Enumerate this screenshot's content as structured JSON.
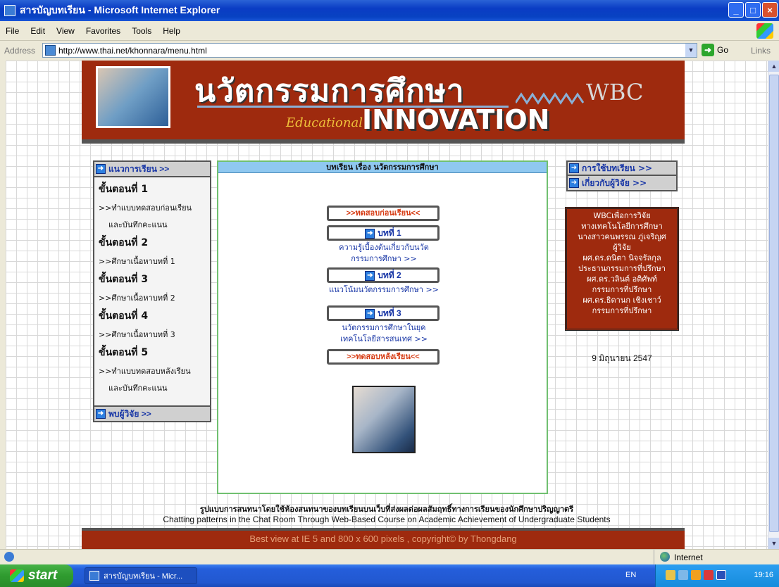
{
  "window": {
    "title": "สารบัญบทเรียน - Microsoft Internet Explorer",
    "minimize": "_",
    "maximize": "□",
    "close": "×"
  },
  "menu": [
    "File",
    "Edit",
    "View",
    "Favorites",
    "Tools",
    "Help"
  ],
  "address": {
    "label": "Address",
    "url": "http://www.thai.net/khonnara/menu.html",
    "go": "Go",
    "links": "Links"
  },
  "banner": {
    "thai_title": "นวัตกรรมการศึกษา",
    "edu": "Educational",
    "innovation": "INNOVATION",
    "wbc": "WBC"
  },
  "left_nav": {
    "header": "แนวการเรียน >>",
    "items": [
      {
        "title": "ขั้นตอนที่ 1",
        "lines": [
          ">>ทำแบบทดสอบก่อนเรียน",
          "และบันทึกคะแนน"
        ]
      },
      {
        "title": "ขั้นตอนที่ 2",
        "lines": [
          ">>ศึกษาเนื้อหาบทที่ 1"
        ]
      },
      {
        "title": "ขั้นตอนที่ 3",
        "lines": [
          ">>ศึกษาเนื้อหาบทที่ 2"
        ]
      },
      {
        "title": "ขั้นตอนที่ 4",
        "lines": [
          ">>ศึกษาเนื้อหาบทที่ 3"
        ]
      },
      {
        "title": "ขั้นตอนที่ 5",
        "lines": [
          ">>ทำแบบทดสอบหลังเรียน",
          "และบันทึกคะแนน"
        ]
      }
    ],
    "footer": "พบผู้วิจัย >>"
  },
  "center": {
    "header": "บทเรียน เรื่อง นวัตกรรมการศึกษา",
    "pretest": ">>ทดสอบก่อนเรียน<<",
    "lesson1": "บทที่ 1",
    "lesson1_desc": [
      "ความรู้เบื้องต้นเกี่ยวกับนวัต",
      "กรรมการศึกษา >>"
    ],
    "lesson2": "บทที่ 2",
    "lesson2_desc": [
      "แนวโน้มนวัตกรรมการศึกษา >>"
    ],
    "lesson3": "บทที่ 3",
    "lesson3_desc": [
      "นวัตกรรมการศึกษาในยุค",
      "เทคโนโลยีสารสนเทศ >>"
    ],
    "posttest": ">>ทดสอบหลังเรียน<<"
  },
  "right_nav": {
    "usage": "การใช้บทเรียน >>",
    "about": "เกี่ยวกับผู้วิจัย >>"
  },
  "info": [
    "WBCเพื่อการวิจัย",
    "ทางเทคโนโลยีการศึกษา",
    "นางสาวคนพรรณ ภู่เจริญศ",
    "ผู้วิจัย",
    "ผศ.ดร.ดนิตา นิจจรัลกุล",
    "ประธานกรรมการที่ปรึกษา",
    "ผศ.ดร.วลินต์ อติศัพท์",
    "กรรมการที่ปรึกษา",
    "ผศ.ดร.ธิดานก เชิงเชาว์",
    "กรรมการที่ปรึกษา"
  ],
  "date": "9 มิถุนายน 2547",
  "footer": {
    "thai": "รูปแบบการสนทนาโดยใช้ห้องสนทนาของบทเรียนบนเว็บที่ส่งผลต่อผลสัมฤทธิ์ทางการเรียนของนักศึกษาปริญญาตรี",
    "english": "Chatting patterns in the Chat Room Through Web-Based Course on Academic Achievement of Undergraduate Students",
    "copyright": "Best view at IE 5 and 800 x 600 pixels , copyright© by Thongdang"
  },
  "status": {
    "zone": "Internet"
  },
  "taskbar": {
    "start": "start",
    "item": "สารบัญบทเรียน - Micr...",
    "lang": "EN",
    "time": "19:16"
  }
}
